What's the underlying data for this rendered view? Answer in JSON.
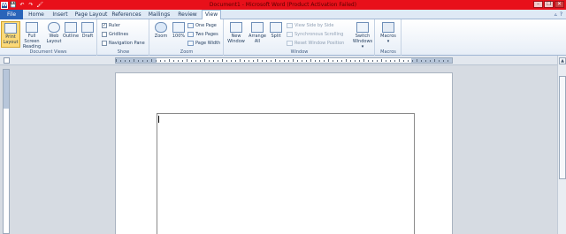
{
  "title_bar": {
    "title": "Document1 - Microsoft Word (Product Activation Failed)",
    "window_buttons": [
      "–",
      "❐",
      "✕"
    ],
    "quick_access": [
      "W",
      "💾",
      "↶",
      "↷",
      "🖌"
    ]
  },
  "tabs": {
    "file": "File",
    "items": [
      "Home",
      "Insert",
      "Page Layout",
      "References",
      "Mailings",
      "Review",
      "View"
    ],
    "active": "View",
    "right_icons": [
      "▵",
      "?"
    ]
  },
  "ribbon": {
    "document_views": {
      "label": "Document Views",
      "buttons": [
        {
          "line1": "Print",
          "line2": "Layout"
        },
        {
          "line1": "Full Screen",
          "line2": "Reading"
        },
        {
          "line1": "Web",
          "line2": "Layout"
        },
        {
          "line1": "Outline",
          "line2": ""
        },
        {
          "line1": "Draft",
          "line2": ""
        }
      ]
    },
    "show": {
      "label": "Show",
      "ruler": "Ruler",
      "gridlines": "Gridlines",
      "navigation_pane": "Navigation Pane",
      "ruler_checked": "✓"
    },
    "zoom": {
      "label": "Zoom",
      "zoom": "Zoom",
      "hundred": "100%",
      "one_page": "One Page",
      "two_pages": "Two Pages",
      "page_width": "Page Width"
    },
    "window": {
      "label": "Window",
      "new_window_1": "New",
      "new_window_2": "Window",
      "arrange_all_1": "Arrange",
      "arrange_all_2": "All",
      "split": "Split",
      "view_side_by_side": "View Side by Side",
      "synchronous_scrolling": "Synchronous Scrolling",
      "reset_window_position": "Reset Window Position",
      "switch_windows_1": "Switch",
      "switch_windows_2": "Windows ▾"
    },
    "macros": {
      "label": "Macros",
      "button_1": "Macros",
      "button_2": "▾"
    }
  },
  "scrollbar": {
    "up": "▲",
    "down": "▼"
  },
  "colors": {
    "titlebar": "#e8101a",
    "file_tab": "#2a64b9",
    "pressed": "#fbd978"
  }
}
